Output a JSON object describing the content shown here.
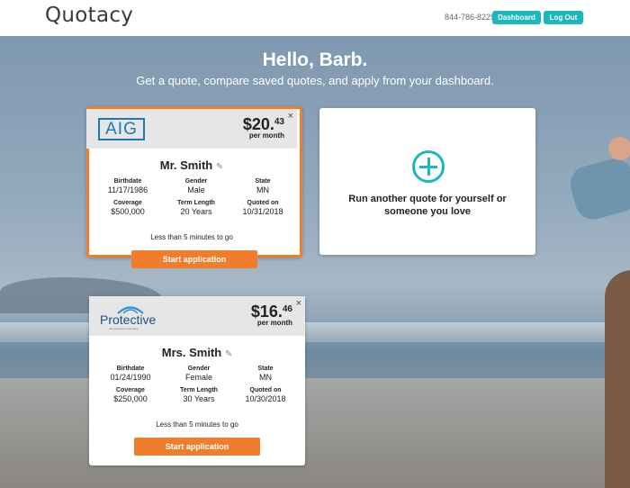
{
  "header": {
    "logo": "Quotacy",
    "phone": "844-786-8229",
    "dashboard_label": "Dashboard",
    "logout_label": "Log Out"
  },
  "greeting": {
    "title": "Hello, Barb.",
    "subtitle": "Get a quote, compare saved quotes, and apply from your dashboard."
  },
  "labels": {
    "birthdate": "Birthdate",
    "gender": "Gender",
    "state": "State",
    "coverage": "Coverage",
    "term_length": "Term Length",
    "quoted_on": "Quoted on",
    "per_month": "per month",
    "close": "×",
    "timer": "Less than 5 minutes to go",
    "start": "Start application"
  },
  "quotes": [
    {
      "carrier": "AIG",
      "price_dollars": "$20.",
      "price_cents": "43",
      "insured": "Mr. Smith",
      "birthdate": "11/17/1986",
      "gender": "Male",
      "state": "MN",
      "coverage": "$500,000",
      "term": "20 Years",
      "quoted_on": "10/31/2018"
    },
    {
      "carrier": "Protective",
      "carrier_sub": "Life Insurance Company",
      "price_dollars": "$16.",
      "price_cents": "46",
      "insured": "Mrs. Smith",
      "birthdate": "01/24/1990",
      "gender": "Female",
      "state": "MN",
      "coverage": "$250,000",
      "term": "30 Years",
      "quoted_on": "10/30/2018"
    }
  ],
  "new_quote": {
    "text": "Run another quote for yourself or someone you love"
  },
  "colors": {
    "accent": "#1bb7bf",
    "cta": "#f07d2b",
    "highlight_border": "#f07d2b"
  }
}
